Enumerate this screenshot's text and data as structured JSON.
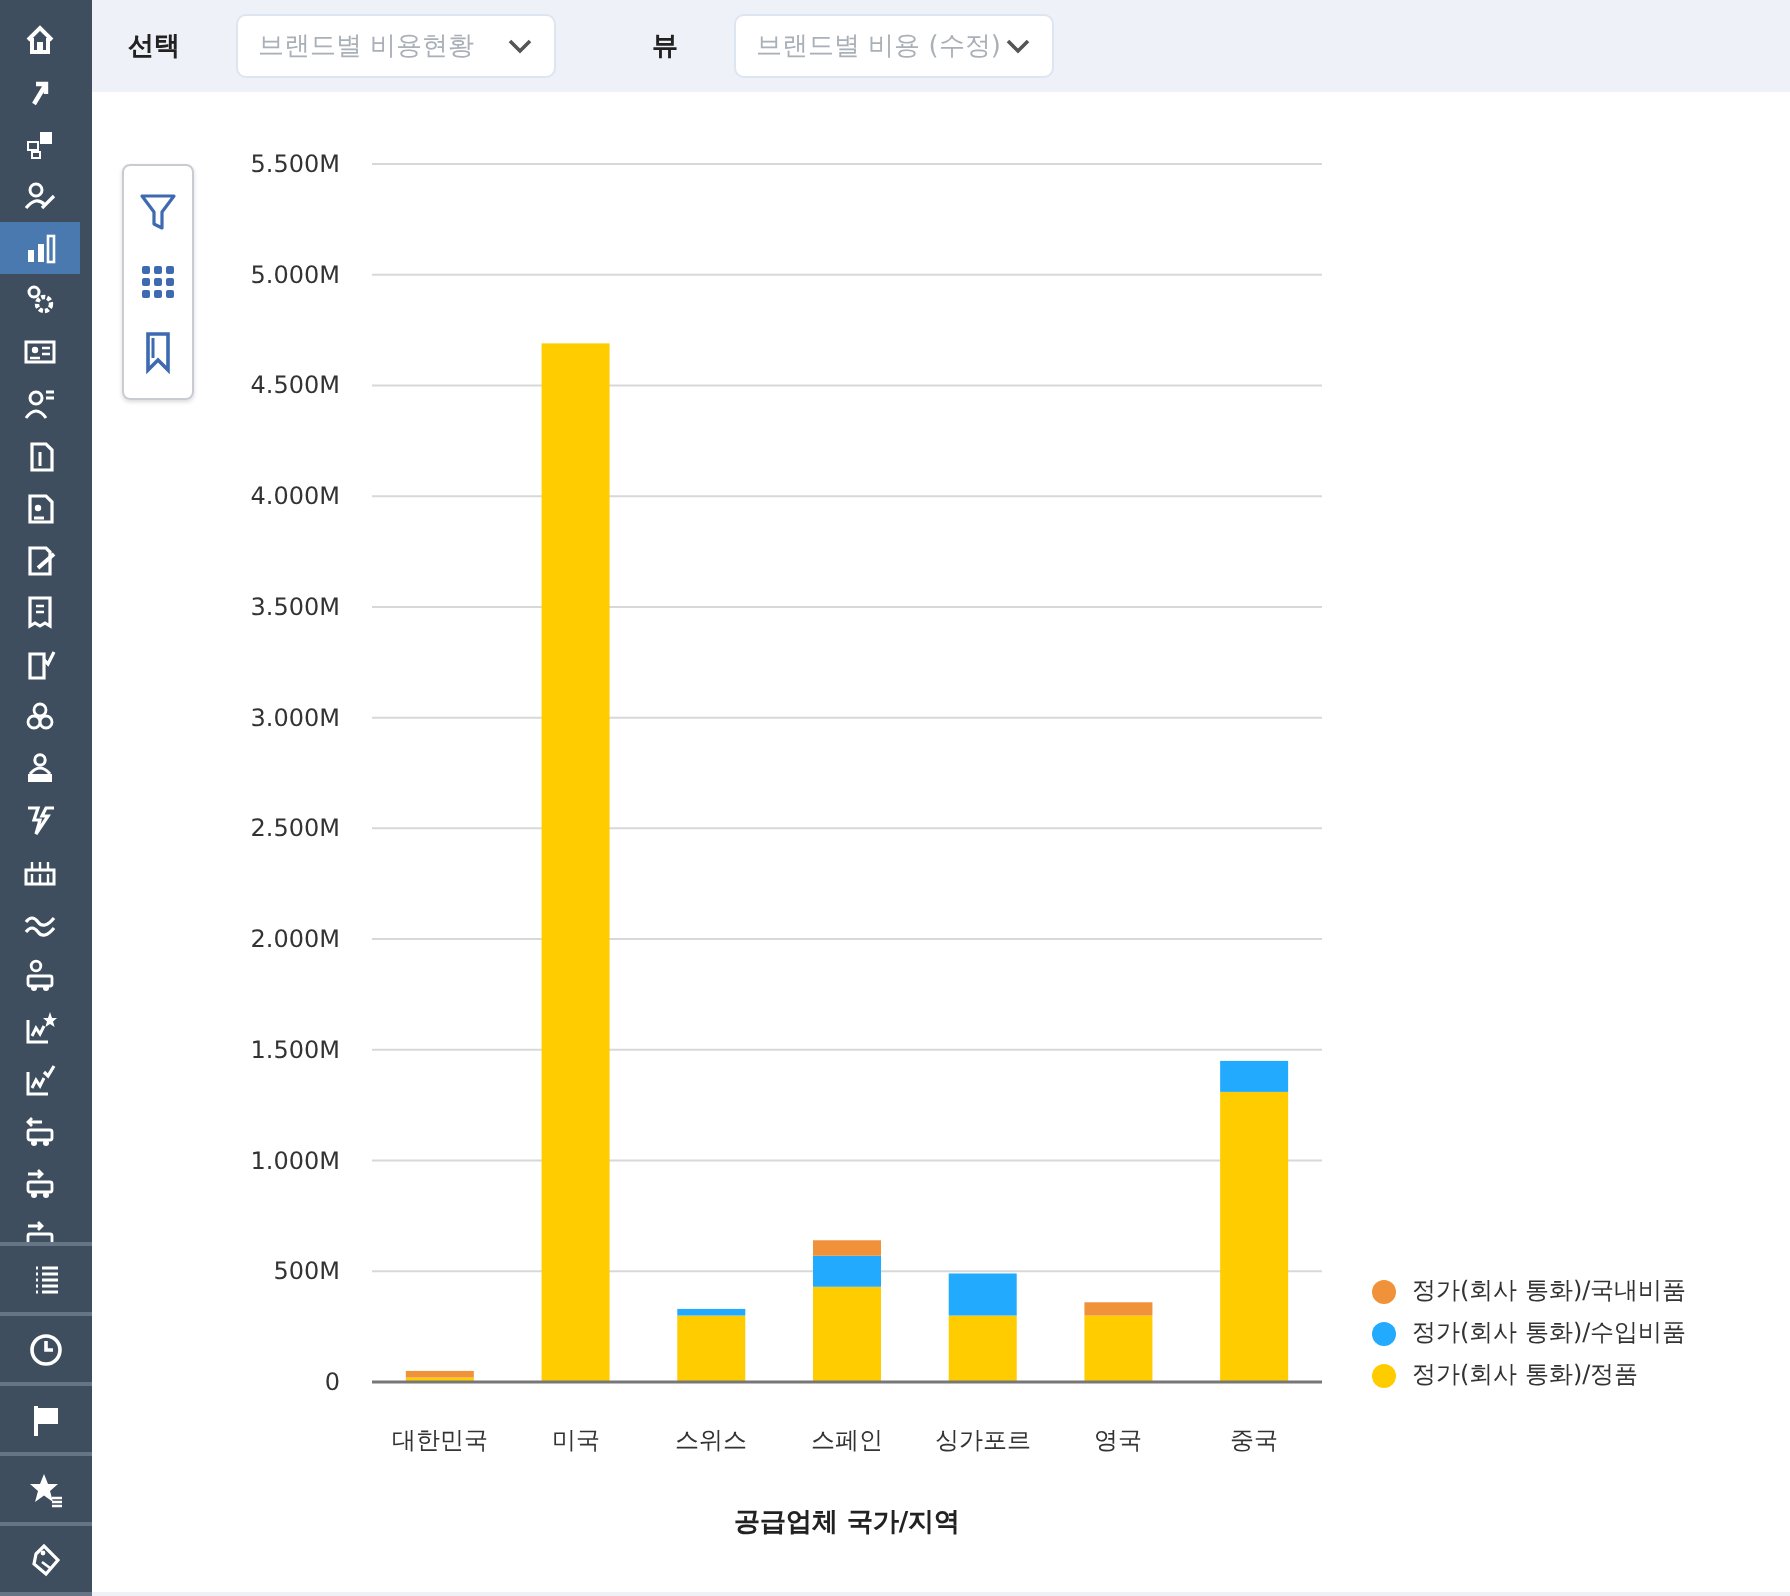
{
  "sidebar": {
    "items": [
      {
        "selected": false
      },
      {
        "selected": false
      },
      {
        "selected": false
      },
      {
        "selected": false
      },
      {
        "selected": true
      },
      {
        "selected": false
      },
      {
        "selected": false
      },
      {
        "selected": false
      },
      {
        "selected": false
      },
      {
        "selected": false
      },
      {
        "selected": false
      },
      {
        "selected": false
      },
      {
        "selected": false
      },
      {
        "selected": false
      },
      {
        "selected": false
      },
      {
        "selected": false
      },
      {
        "selected": false
      },
      {
        "selected": false
      },
      {
        "selected": false
      },
      {
        "selected": false
      },
      {
        "selected": false
      },
      {
        "selected": false
      },
      {
        "selected": false
      },
      {
        "selected": false
      }
    ],
    "bottom_items": [
      {
        "selected": false
      },
      {
        "selected": false
      },
      {
        "selected": false
      },
      {
        "selected": false
      },
      {
        "selected": false
      }
    ]
  },
  "toolbar": {
    "filters": [
      {
        "label": "선택",
        "value": "브랜드별 비용현황"
      },
      {
        "label": "뷰",
        "value": "브랜드별 비용 (수정)"
      }
    ]
  },
  "chart": {
    "chart_data": {
      "type": "bar",
      "stacked": true,
      "grid": true,
      "xlabel": "공급업체 국가/지역",
      "categories": [
        "대한민국",
        "미국",
        "스위스",
        "스페인",
        "싱가포르",
        "영국",
        "중국"
      ],
      "series": [
        {
          "name": "정가(회사 통화)/정품",
          "color": "#ffcc00",
          "values": [
            20,
            4690,
            300,
            430,
            300,
            300,
            1310
          ]
        },
        {
          "name": "정가(회사 통화)/수입비품",
          "color": "#22aaff",
          "values": [
            0,
            0,
            30,
            140,
            190,
            0,
            140
          ]
        },
        {
          "name": "정가(회사 통화)/국내비품",
          "color": "#f0923a",
          "values": [
            30,
            0,
            0,
            70,
            0,
            60,
            0
          ]
        }
      ],
      "ylim": [
        0,
        5500
      ],
      "yticks": [
        {
          "value": 0,
          "label": "0"
        },
        {
          "value": 500,
          "label": "500M"
        },
        {
          "value": 1000,
          "label": "1.000M"
        },
        {
          "value": 1500,
          "label": "1.500M"
        },
        {
          "value": 2000,
          "label": "2.000M"
        },
        {
          "value": 2500,
          "label": "2.500M"
        },
        {
          "value": 3000,
          "label": "3.000M"
        },
        {
          "value": 3500,
          "label": "3.500M"
        },
        {
          "value": 4000,
          "label": "4.000M"
        },
        {
          "value": 4500,
          "label": "4.500M"
        },
        {
          "value": 5000,
          "label": "5.000M"
        },
        {
          "value": 5500,
          "label": "5.500M"
        }
      ]
    }
  }
}
